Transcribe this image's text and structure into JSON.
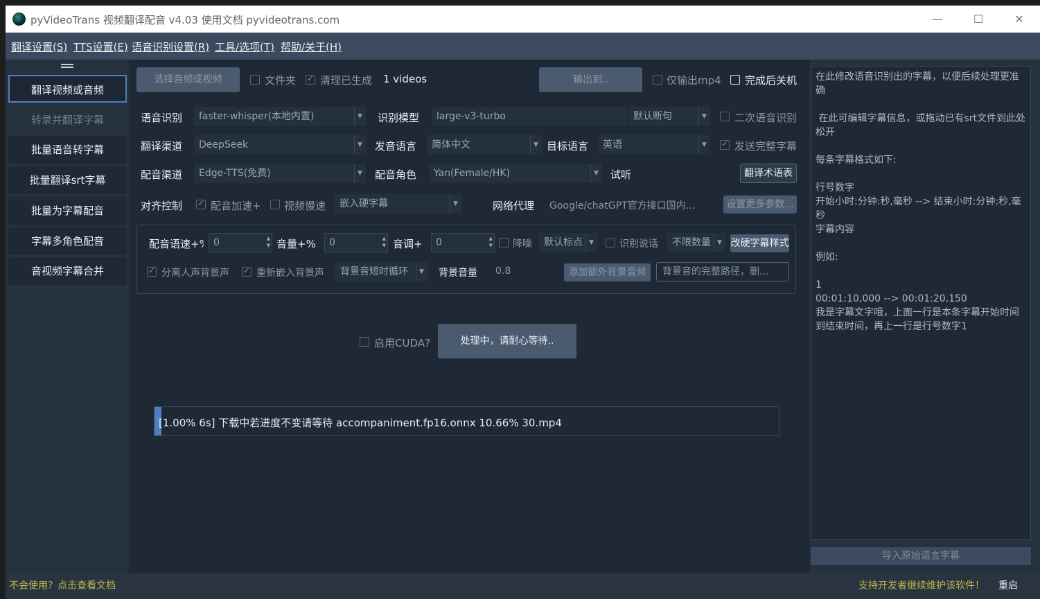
{
  "window": {
    "title": "pyVideoTrans 视频翻译配音 v4.03 使用文档 pyvideotrans.com",
    "min_symbol": "—",
    "max_symbol": "☐",
    "close_symbol": "✕"
  },
  "menu": [
    "翻译设置(S)",
    "TTS设置(E)",
    "语音识别设置(R)",
    "工具/选项(T)",
    "帮助/关于(H)"
  ],
  "sidebar": {
    "handle_icon": "menu-handle",
    "items": [
      "翻译视频或音频",
      "转录并翻译字幕",
      "批量语音转字幕",
      "批量翻译srt字幕",
      "批量为字幕配音",
      "字幕多角色配音",
      "音视频字幕合并"
    ]
  },
  "toolbar": {
    "select_btn": "选择音频或视频",
    "folder_label": "文件夹",
    "clean_label": "清理已生成",
    "videos_count": "1 videos",
    "output_btn": "输出到..",
    "mp4_only_label": "仅输出mp4",
    "shutdown_label": "完成后关机"
  },
  "row_recognition": {
    "label": "语音识别",
    "value": "faster-whisper(本地内置)",
    "model_label": "识别模型",
    "model_value": "large-v3-turbo",
    "split_value": "默认断句",
    "second_label": "二次语音识别"
  },
  "row_translate": {
    "label": "翻译渠道",
    "value": "DeepSeek",
    "source_label": "发音语言",
    "source_value": "简体中文",
    "target_label": "目标语言",
    "target_value": "英语",
    "send_full_label": "发送完整字幕"
  },
  "row_dubbing": {
    "label": "配音渠道",
    "value": "Edge-TTS(免费)",
    "role_label": "配音角色",
    "role_value": "Yan(Female/HK)",
    "listen_label": "试听",
    "glossary_btn": "翻译术语表"
  },
  "row_align": {
    "label": "对齐控制",
    "speedup_label": "配音加速+",
    "slow_label": "视频慢速",
    "embed_value": "嵌入硬字幕",
    "proxy_label": "网络代理",
    "proxy_placeholder": "Google/chatGPT官方接口国内...",
    "more_btn": "设置更多参数..."
  },
  "group": {
    "rate_label": "配音语速+%",
    "rate_value": "0",
    "volume_label": "音量+%",
    "volume_value": "0",
    "pitch_label": "音调+",
    "pitch_value": "0",
    "denoise_label": "降噪",
    "punct_value": "默认标点",
    "speaker_label": "识别说话",
    "speaker_count_value": "不限数量",
    "style_btn": "改硬字幕样式",
    "separate_label": "分离人声背景声",
    "reembed_label": "重新嵌入背景声",
    "bg_loop_value": "背景音短时循环",
    "bg_volume_label": "背景音量",
    "bg_volume_value": "0.8",
    "add_bg_btn": "添加额外背景音频",
    "bg_path_placeholder": "背景音的完整路径，删..."
  },
  "run": {
    "cuda_label": "启用CUDA?",
    "processing_btn": "处理中，请耐心等待.."
  },
  "progress": {
    "percent": 1.0,
    "text": "[1.00%  6s]  下载中若进度不变请等待 accompaniment.fp16.onnx 10.66% 30.mp4"
  },
  "right_panel": {
    "text": "在此修改语音识别出的字幕，以便后续处理更准确\n\n 在此可编辑字幕信息，或拖动已有srt文件到此处松开\n\n每条字幕格式如下:\n\n行号数字\n开始小时:分钟:秒,毫秒 --> 结束小时:分钟:秒,毫秒\n字幕内容\n\n例如:\n\n1\n00:01:10,000 --> 00:01:20,150\n我是字幕文字哦，上面一行是本条字幕开始时间到结束时间，再上一行是行号数字1",
    "import_btn": "导入原始语言字幕"
  },
  "status": {
    "help_link": "不会使用？点击查看文档",
    "support_link": "支持开发者继续维护该软件！",
    "restart": "重启"
  },
  "colors": {
    "window_bg": "#1f2935",
    "menubar_bg": "#3b4a5e",
    "accent": "#4e7fbf",
    "status_text": "#c0b84a"
  }
}
